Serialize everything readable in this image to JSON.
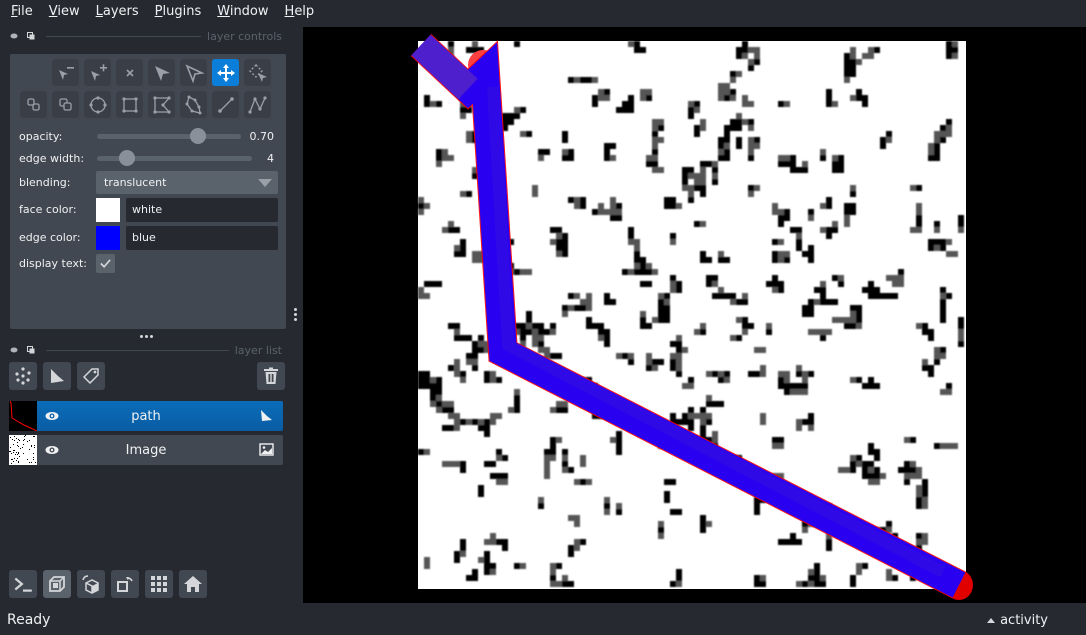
{
  "menubar": {
    "items": [
      {
        "mnemonic": "F",
        "rest": "ile"
      },
      {
        "mnemonic": "V",
        "rest": "iew"
      },
      {
        "mnemonic": "L",
        "rest": "ayers"
      },
      {
        "mnemonic": "P",
        "rest": "lugins"
      },
      {
        "mnemonic": "W",
        "rest": "indow"
      },
      {
        "mnemonic": "H",
        "rest": "elp"
      }
    ]
  },
  "layer_controls": {
    "title": "layer controls",
    "tools_row1": [
      "remove-vertex",
      "add-vertex",
      "delete-shape",
      "select-shape",
      "direct-select-vertex",
      "pan-zoom",
      "select-region"
    ],
    "tools_row2": [
      "move-back",
      "move-front",
      "add-ellipse",
      "add-rectangle",
      "add-polygon",
      "add-polygon-lasso",
      "add-line",
      "add-path"
    ],
    "active_tool": "pan-zoom",
    "opacity": {
      "label": "opacity:",
      "value": 0.7,
      "display": "0.70"
    },
    "edge_width": {
      "label": "edge width:",
      "value": 4,
      "display": "4",
      "max": 40
    },
    "blending": {
      "label": "blending:",
      "value": "translucent"
    },
    "face_color": {
      "label": "face color:",
      "value": "white",
      "swatch": "#ffffff"
    },
    "edge_color": {
      "label": "edge color:",
      "value": "blue",
      "swatch": "#0000ff"
    },
    "display_text": {
      "label": "display text:",
      "checked": true
    }
  },
  "layer_list": {
    "title": "layer list",
    "layers": [
      {
        "name": "path",
        "type": "shapes",
        "visible": true,
        "selected": true
      },
      {
        "name": "Image",
        "type": "image",
        "visible": true,
        "selected": false
      }
    ]
  },
  "status": {
    "text": "Ready",
    "activity_label": "activity"
  },
  "colors": {
    "accent": "#0a7ed8",
    "path_edge": "#0000ff",
    "path_highlight": "#ff0000"
  }
}
